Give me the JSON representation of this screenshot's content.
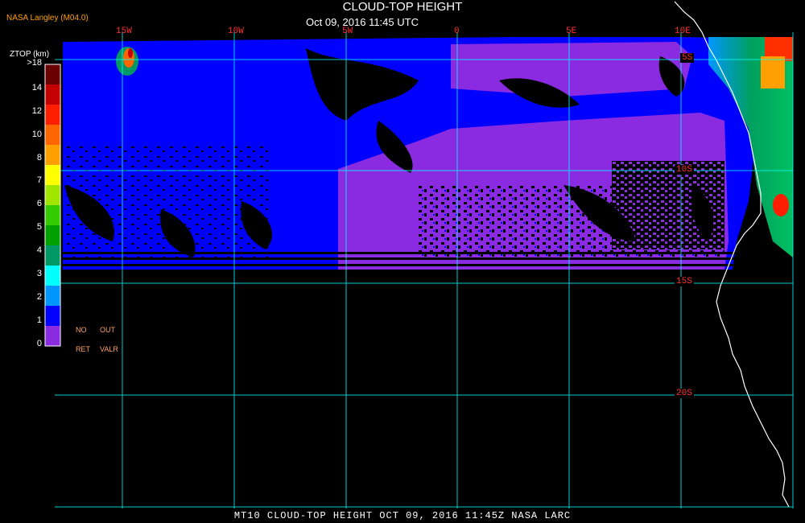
{
  "header": {
    "title": "CLOUD-TOP HEIGHT",
    "timestamp": "Oct 09, 2016 11:45 UTC",
    "credit": "NASA Langley (M04.0)"
  },
  "legend": {
    "title": "ZTOP (km)",
    "ticks": [
      ">18",
      "14",
      "12",
      "10",
      "8",
      "7",
      "6",
      "5",
      "4",
      "3",
      "2",
      "1",
      "0"
    ],
    "colors": [
      "#6b0000",
      "#c40000",
      "#ff1e00",
      "#ff6600",
      "#ffa000",
      "#ffff00",
      "#a0e600",
      "#33cc00",
      "#00a000",
      "#009966",
      "#00ffff",
      "#0096ff",
      "#0000ff",
      "#8a2be2"
    ],
    "no_ret_top": "NO",
    "no_ret_bottom": "RET",
    "out_valr_top": "OUT",
    "out_valr_bottom": "VALR"
  },
  "grid": {
    "longitudes": [
      "15W",
      "10W",
      "5W",
      "0",
      "5E",
      "10E"
    ],
    "latitudes": [
      "5S",
      "10S",
      "15S",
      "20S"
    ]
  },
  "footer": {
    "text": "MT10  CLOUD-TOP HEIGHT  OCT 09, 2016 11:45Z  NASA LARC"
  }
}
